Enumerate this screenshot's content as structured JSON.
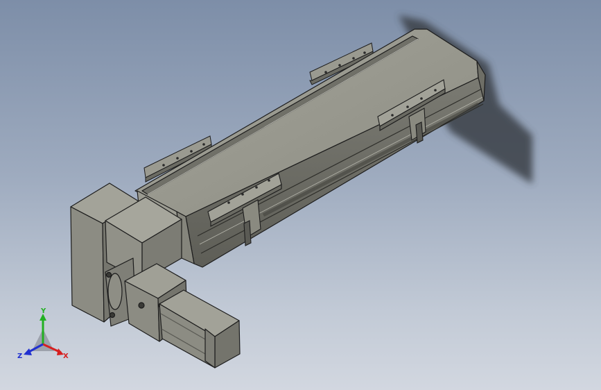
{
  "viewport": {
    "background_top": "#7d8ea8",
    "background_bottom": "#d2d7e0"
  },
  "model": {
    "body_color": "#8f8f85",
    "edge_color": "#1c1c1c",
    "shadow_color": "#3a3f46"
  },
  "triad": {
    "x_label": "X",
    "y_label": "Y",
    "z_label": "Z",
    "x_color": "#d62020",
    "y_color": "#22b022",
    "z_color": "#2030d0"
  }
}
